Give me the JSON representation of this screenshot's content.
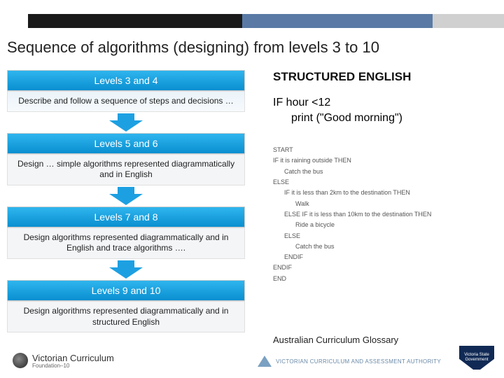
{
  "title": "Sequence of algorithms (designing) from levels 3 to 10",
  "levels": [
    {
      "head": "Levels 3 and 4",
      "body": "Describe and follow a sequence of steps and decisions …"
    },
    {
      "head": "Levels 5 and 6",
      "body": "Design … simple algorithms represented diagrammatically and in English"
    },
    {
      "head": "Levels 7 and 8",
      "body": "Design algorithms represented diagrammatically and in English and trace algorithms …."
    },
    {
      "head": "Levels 9 and 10",
      "body": "Design algorithms represented diagrammatically and in structured English"
    }
  ],
  "structured_english": {
    "heading": "STRUCTURED ENGLISH",
    "line1": "IF hour <12",
    "line2": "print (\"Good morning\")"
  },
  "pseudo": {
    "start": "START",
    "l1": "IF it is raining outside THEN",
    "l1a": "Catch the bus",
    "l2": "ELSE",
    "l3": "IF it is less than 2km to the destination THEN",
    "l3a": "Walk",
    "l4": "ELSE IF it is less than 10km to the destination THEN",
    "l4a": "Ride a bicycle",
    "l5": "ELSE",
    "l5a": "Catch the bus",
    "l6": "ENDIF",
    "l7": "ENDIF",
    "end": "END"
  },
  "glossary": "Australian Curriculum Glossary",
  "footer": {
    "vc_name": "Victorian Curriculum",
    "vc_sub": "Foundation–10",
    "vcaa": "VICTORIAN CURRICULUM AND ASSESSMENT AUTHORITY",
    "shield": "Victoria State Government"
  },
  "colors": {
    "accent": "#0a9fe0",
    "bar_navy": "#1a1a1a",
    "bar_blue": "#5a7aa5"
  }
}
